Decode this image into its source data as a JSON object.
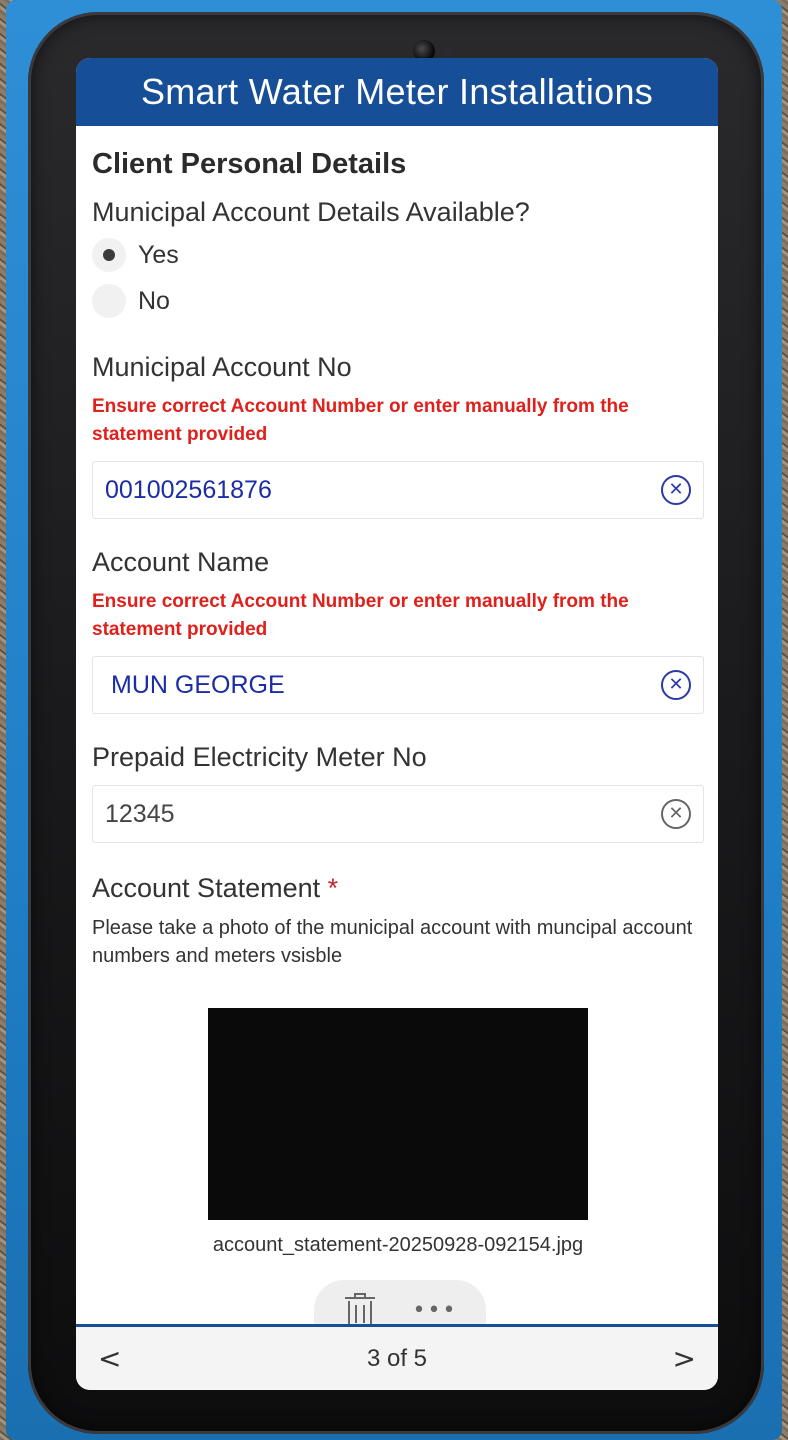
{
  "app": {
    "title": "Smart Water Meter Installations"
  },
  "section": {
    "title": "Client Personal Details"
  },
  "account_details_question": {
    "label": "Municipal Account Details Available?",
    "options": [
      {
        "label": "Yes",
        "selected": true
      },
      {
        "label": "No",
        "selected": false
      }
    ]
  },
  "account_no": {
    "label": "Municipal Account No",
    "hint": "Ensure correct Account Number or enter manually from the statement provided",
    "value": "001002561876"
  },
  "account_name": {
    "label": "Account Name",
    "hint": "Ensure correct Account Number or enter manually from the statement provided",
    "value": "MUN GEORGE"
  },
  "electricity_meter": {
    "label": "Prepaid Electricity Meter No",
    "value": "12345"
  },
  "account_statement": {
    "label": "Account Statement",
    "required_marker": "*",
    "description": "Please take a photo of the municipal account with muncipal account numbers and meters vsisble",
    "filename": "account_statement-20250928-092154.jpg"
  },
  "icons": {
    "clear": "clear-circle-icon",
    "trash": "trash-icon",
    "more": "more-icon",
    "prev": "chevron-left-icon",
    "next": "chevron-right-icon"
  },
  "footer": {
    "page_indicator": "3 of 5",
    "prev_glyph": "<",
    "next_glyph": ">"
  },
  "colors": {
    "header": "#164f97",
    "input_text": "#1c2ca6",
    "hint": "#e0201b",
    "required": "#c4282b",
    "case_blue": "#1f7fc7"
  }
}
